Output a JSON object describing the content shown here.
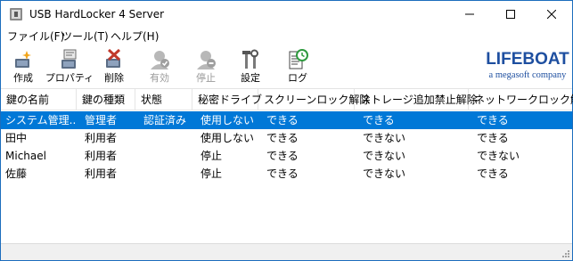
{
  "window": {
    "title": "USB HardLocker 4 Server"
  },
  "menu": [
    {
      "label": "ファイル(F)"
    },
    {
      "label": "ツール(T)"
    },
    {
      "label": "ヘルプ(H)"
    }
  ],
  "toolbar": [
    {
      "label": "作成",
      "icon": "key-create-icon",
      "enabled": true
    },
    {
      "label": "プロパティ",
      "icon": "properties-icon",
      "enabled": true
    },
    {
      "label": "削除",
      "icon": "delete-icon",
      "enabled": true
    },
    {
      "label": "有効",
      "icon": "enable-icon",
      "enabled": false
    },
    {
      "label": "停止",
      "icon": "stop-icon",
      "enabled": false
    },
    {
      "label": "設定",
      "icon": "settings-icon",
      "enabled": true
    },
    {
      "label": "ログ",
      "icon": "log-icon",
      "enabled": true
    }
  ],
  "logo": {
    "name": "LIFEBOAT",
    "tagline": "a megasoft company",
    "color": "#1e4fa0"
  },
  "table": {
    "columns": [
      "鍵の名前",
      "鍵の種類",
      "状態",
      "秘密ドライブ",
      "スクリーンロック解除",
      "ストレージ追加禁止解除",
      "ネットワークロック解除"
    ],
    "rows": [
      [
        "システム管理...",
        "管理者",
        "認証済み",
        "使用しない",
        "できる",
        "できる",
        "できる"
      ],
      [
        "田中",
        "利用者",
        "",
        "使用しない",
        "できる",
        "できない",
        "できる"
      ],
      [
        "Michael",
        "利用者",
        "",
        "停止",
        "できる",
        "できない",
        "できない"
      ],
      [
        "佐藤",
        "利用者",
        "",
        "停止",
        "できる",
        "できない",
        "できる"
      ]
    ],
    "selected_row": 0
  },
  "colors": {
    "selection": "#0078d7",
    "accent_border": "#1c6dbd"
  }
}
